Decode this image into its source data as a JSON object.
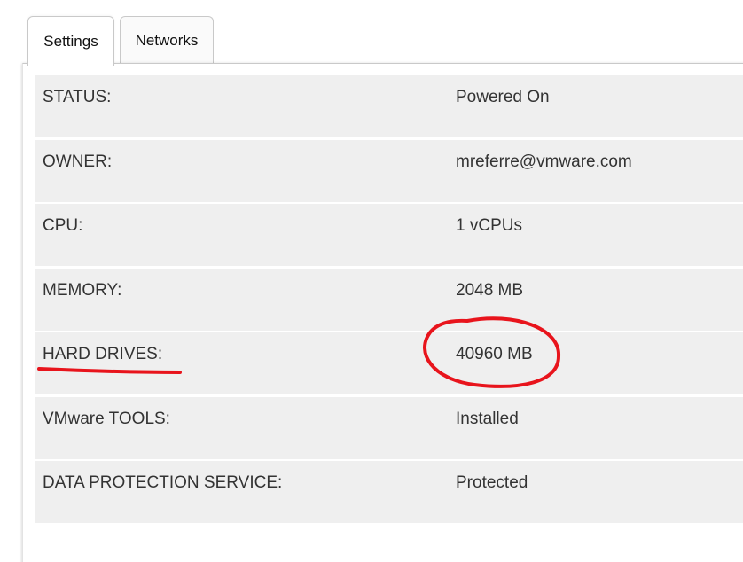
{
  "tabs": [
    {
      "label": "Settings",
      "active": true
    },
    {
      "label": "Networks",
      "active": false
    }
  ],
  "properties": [
    {
      "label": "STATUS:",
      "value": "Powered On"
    },
    {
      "label": "OWNER:",
      "value": "mreferre@vmware.com"
    },
    {
      "label": "CPU:",
      "value": "1 vCPUs"
    },
    {
      "label": "MEMORY:",
      "value": "2048 MB"
    },
    {
      "label": "HARD DRIVES:",
      "value": "40960 MB"
    },
    {
      "label": "VMware TOOLS:",
      "value": "Installed"
    },
    {
      "label": "DATA PROTECTION SERVICE:",
      "value": "Protected"
    }
  ],
  "annotations": {
    "color": "#e8141c",
    "underline_target": "HARD DRIVES:",
    "circle_target": "40960 MB"
  }
}
